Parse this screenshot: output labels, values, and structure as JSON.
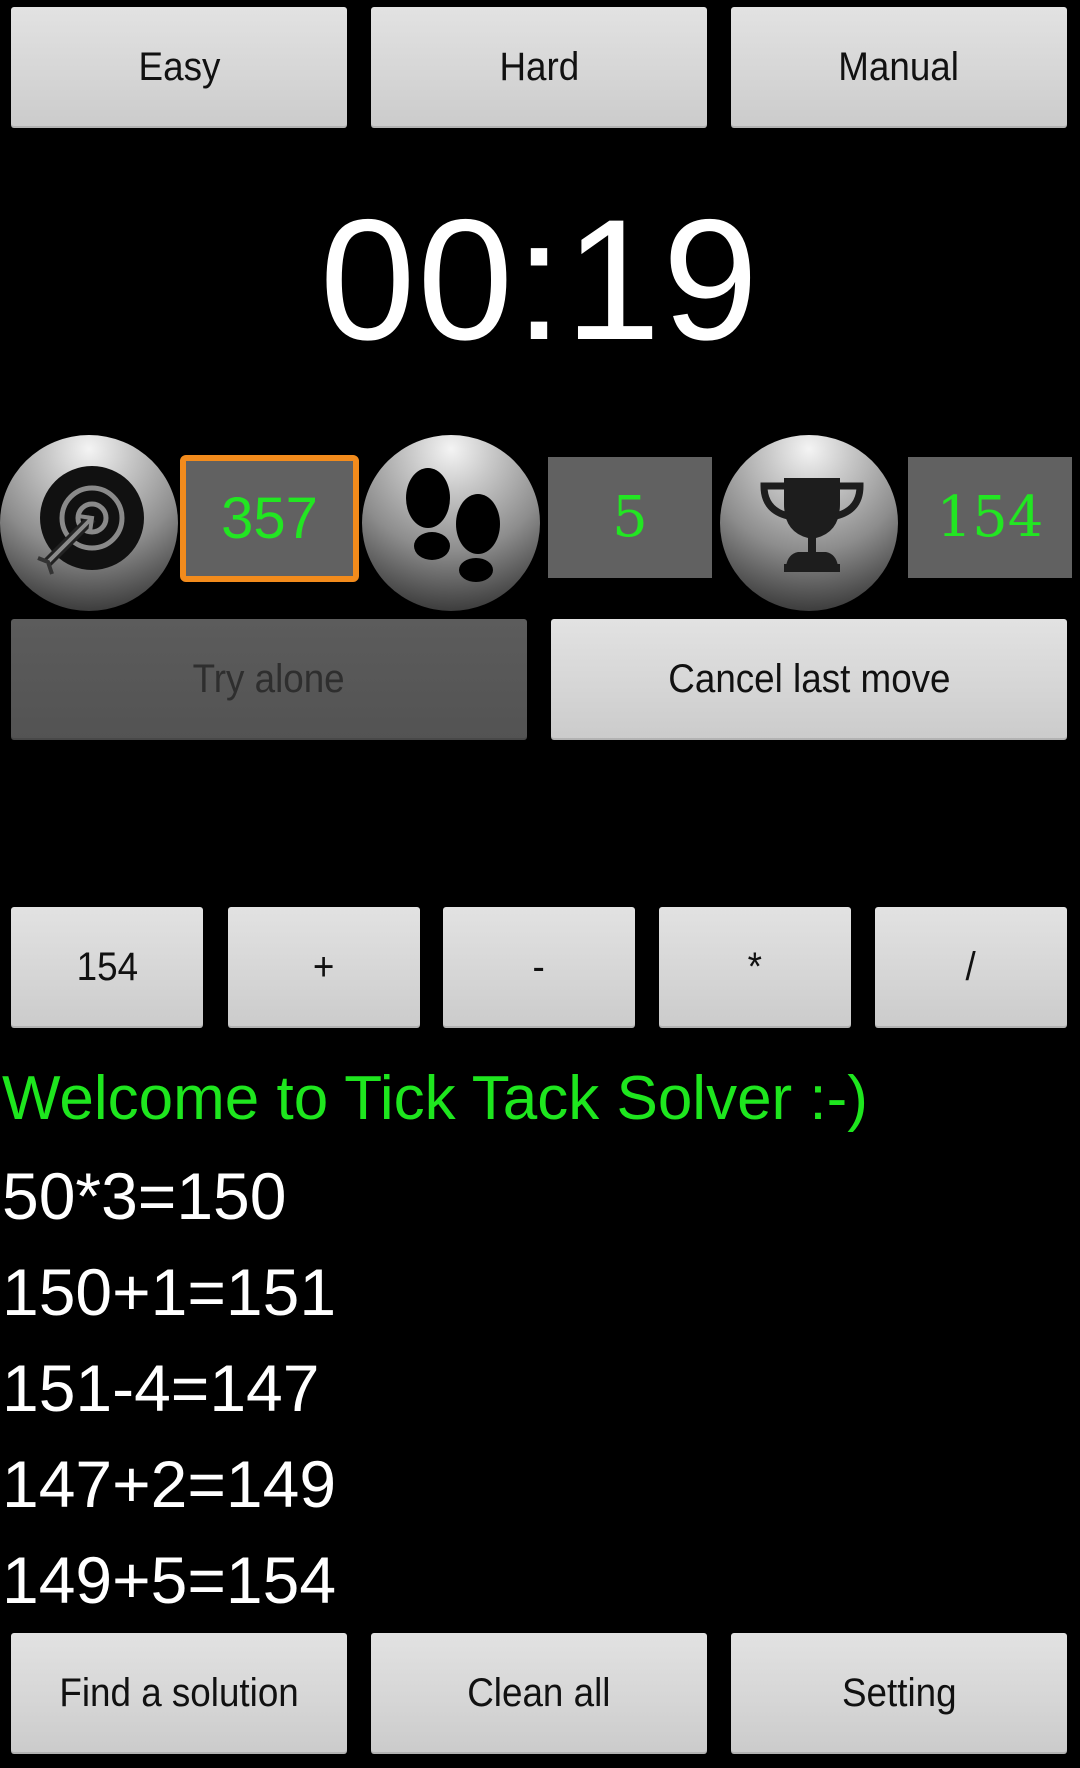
{
  "mode_buttons": [
    {
      "label": "Easy"
    },
    {
      "label": "Hard"
    },
    {
      "label": "Manual"
    }
  ],
  "timer": "00:19",
  "stats": {
    "target": {
      "icon": "target-icon",
      "value": "357",
      "selected": true
    },
    "moves": {
      "icon": "footprints-icon",
      "value": "5"
    },
    "best": {
      "icon": "trophy-icon",
      "value": "154"
    }
  },
  "actions": {
    "try_alone": {
      "label": "Try alone",
      "enabled": false
    },
    "cancel_last_move": {
      "label": "Cancel last move",
      "enabled": true
    }
  },
  "operator_row": [
    {
      "label": "154"
    },
    {
      "label": "+"
    },
    {
      "label": "-"
    },
    {
      "label": "*"
    },
    {
      "label": "/"
    }
  ],
  "log": {
    "welcome": "Welcome to Tick Tack Solver :-)",
    "steps": [
      "50*3=150",
      "150+1=151",
      "151-4=147",
      "147+2=149",
      "149+5=154"
    ]
  },
  "bottom_buttons": [
    {
      "label": "Find a solution"
    },
    {
      "label": "Clean all"
    },
    {
      "label": "Setting"
    }
  ],
  "colors": {
    "accent_green": "#22e622",
    "selected_border": "#f28b1c",
    "background": "#000000"
  }
}
